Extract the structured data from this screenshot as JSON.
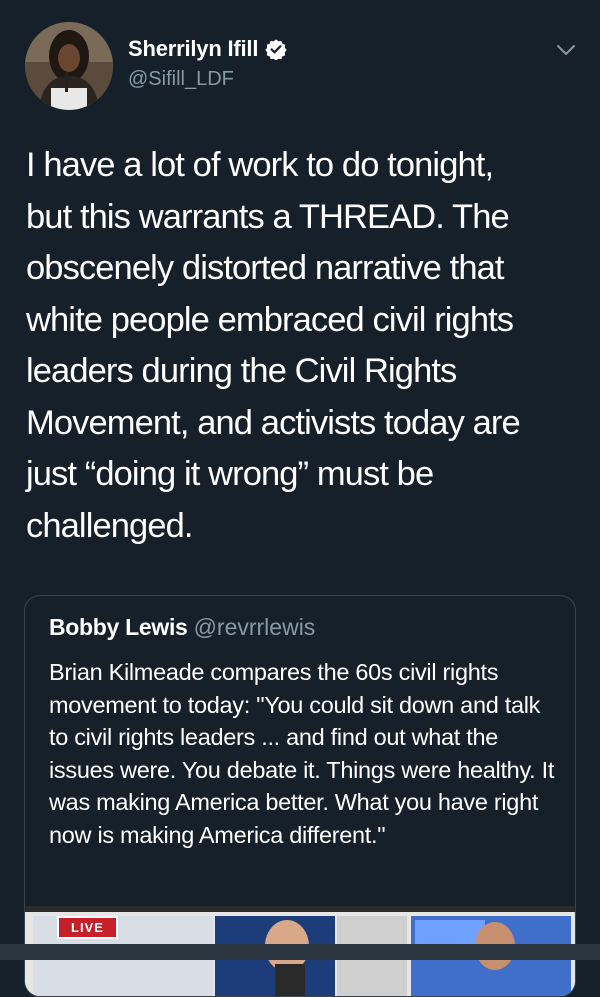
{
  "author": {
    "display_name": "Sherrilyn Ifill",
    "handle": "@Sifill_LDF",
    "verified": true,
    "avatar": "avatar-photo"
  },
  "tweet": {
    "text": "I have a lot of work to do tonight,\nbut this warrants a THREAD. The\nobscenely distorted narrative that\nwhite people embraced civil rights\nleaders during the Civil Rights\nMovement, and activists today are\njust “doing it wrong” must be\nchallenged."
  },
  "quoted_tweet": {
    "display_name": "Bobby Lewis",
    "handle": "@revrrlewis",
    "text": "Brian Kilmeade compares the 60s civil rights movement to today: \"You could sit down and talk to civil rights leaders ... and find out what the issues were. You debate it. Things were healthy. It was making America better. What you have right now is making America different.\"",
    "media_badge": "LIVE"
  },
  "icons": {
    "verified": "verified-badge-icon",
    "menu": "chevron-down-icon"
  },
  "colors": {
    "background": "#15202b",
    "secondary_text": "#8899a6",
    "border": "#38444d",
    "live_red": "#c8202a"
  }
}
